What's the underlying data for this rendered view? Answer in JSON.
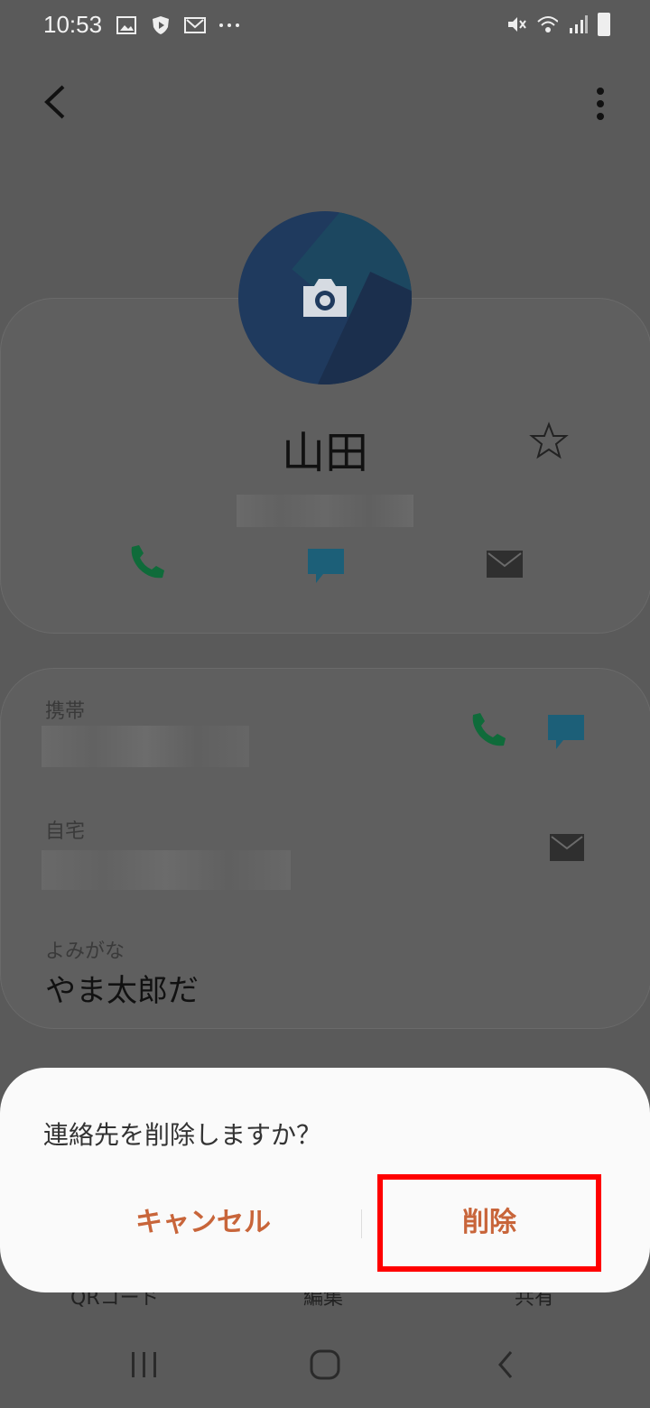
{
  "status_bar": {
    "time": "10:53"
  },
  "contact": {
    "name": "山田",
    "fields": [
      {
        "label": "携帯"
      },
      {
        "label": "自宅"
      },
      {
        "label": "よみがな",
        "value": "やま太郎だ"
      }
    ]
  },
  "bottom_actions": [
    "QRコード",
    "編集",
    "共有"
  ],
  "dialog": {
    "title": "連絡先を削除しますか？",
    "cancel_label": "キャンセル",
    "delete_label": "削除"
  },
  "colors": {
    "accent": "#c8653a",
    "highlight_box": "#ff0000",
    "call_green": "#0f6b3a",
    "message_blue": "#1c5f78"
  }
}
